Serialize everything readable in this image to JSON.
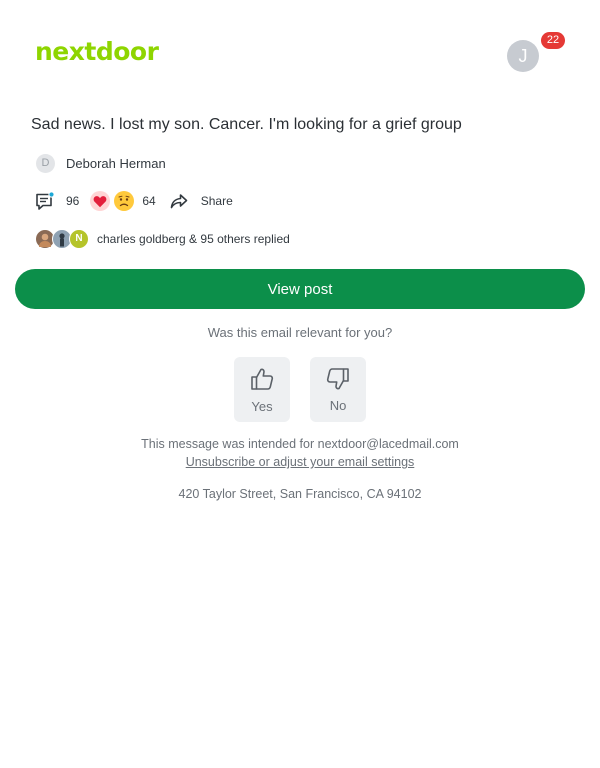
{
  "brand": {
    "logo_text": "nextdoor",
    "logo_color": "#8ed500"
  },
  "account": {
    "avatar_initial": "J",
    "notification_count": "22"
  },
  "post": {
    "title": "Sad news. I lost my son. Cancer. I'm looking for a grief group",
    "author_initial": "D",
    "author_name": "Deborah Herman",
    "comment_count": "96",
    "reaction_count": "64",
    "share_label": "Share",
    "reactions": [
      "heart-emoji",
      "sad-face-emoji"
    ],
    "replies_avatar_initial": "N",
    "replies_text": "charles goldberg & 95 others replied"
  },
  "actions": {
    "view_post_label": "View post",
    "view_post_color": "#0c8f4a"
  },
  "feedback": {
    "question": "Was this email relevant for you?",
    "yes_label": "Yes",
    "no_label": "No",
    "yes_icon": "thumbs-up-icon",
    "no_icon": "thumbs-down-icon"
  },
  "footer": {
    "intended_text": "This message was intended for nextdoor@lacedmail.com",
    "unsubscribe_text": "Unsubscribe or adjust your email settings",
    "address": "420 Taylor Street, San Francisco, CA 94102"
  }
}
